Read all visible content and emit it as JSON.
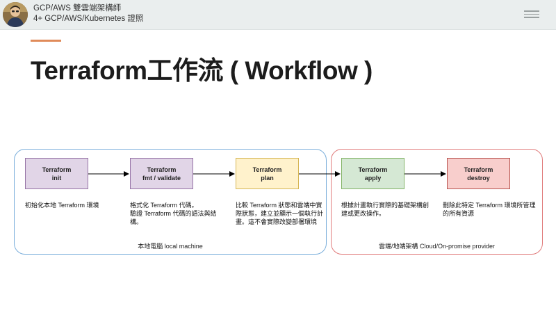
{
  "header": {
    "author_line1": "GCP/AWS 雙雲端架構師",
    "author_line2": "4+ GCP/AWS/Kubernetes 證照",
    "avatar_icon": "profile-photo",
    "menu_icon": "hamburger-menu-icon"
  },
  "slide": {
    "title": "Terraform工作流 ( Workflow )",
    "accent_color": "#e08b5a"
  },
  "regions": {
    "local": {
      "label": "本地電腦 local machine",
      "color": "#7aaedb"
    },
    "cloud": {
      "label": "雲端/地端架構 Cloud/On-promise provider",
      "color": "#e07a7a"
    }
  },
  "steps": [
    {
      "line1": "Terraform",
      "line2": "init",
      "fill": "#e1d5e7",
      "border": "#9673a6",
      "desc": "初始化本地 Terraform 環境"
    },
    {
      "line1": "Terraform",
      "line2": "fmt / validate",
      "fill": "#e1d5e7",
      "border": "#9673a6",
      "desc": "格式化 Terraform 代碼。\n驗證 Terraform 代碼的語法與結構。"
    },
    {
      "line1": "Terraform",
      "line2": "plan",
      "fill": "#fff2cc",
      "border": "#d6b656",
      "desc": "比較 Terraform 狀態和雲端中實際狀態，建立並顯示一個執行計畫。這不會實際改變部署環境"
    },
    {
      "line1": "Terraform",
      "line2": "apply",
      "fill": "#d5e8d4",
      "border": "#82b366",
      "desc": "根據計畫執行實際的基礎架構創建或更改操作。"
    },
    {
      "line1": "Terraform",
      "line2": "destroy",
      "fill": "#f8cecc",
      "border": "#b85450",
      "desc": "刪除此特定 Terraform 環境所管理的所有資源"
    }
  ]
}
